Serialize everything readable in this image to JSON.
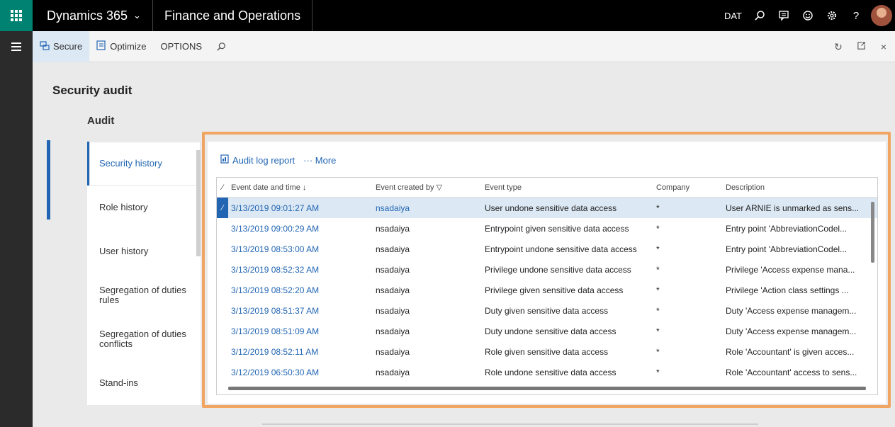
{
  "topbar": {
    "brand": "Dynamics 365",
    "app_name": "Finance and Operations",
    "company": "DAT",
    "icons": [
      "waffle-icon",
      "search-icon",
      "chat-icon",
      "smiley-icon",
      "gear-icon",
      "help-icon",
      "avatar"
    ]
  },
  "actionpane": {
    "secure": "Secure",
    "optimize": "Optimize",
    "options": "OPTIONS"
  },
  "page": {
    "title": "Security audit",
    "section": "Audit"
  },
  "vtabs": [
    {
      "label": "Security history"
    },
    {
      "label": "Role history"
    },
    {
      "label": "User history"
    },
    {
      "label": "Segregation of duties rules"
    },
    {
      "label": "Segregation of duties conflicts"
    },
    {
      "label": "Stand-ins"
    }
  ],
  "toolbar": {
    "audit_log_report": "Audit log report",
    "more": "··· More"
  },
  "grid": {
    "headers": {
      "date": "Event date and time ↓",
      "created_by": "Event created by",
      "event_type": "Event type",
      "company": "Company",
      "description": "Description"
    },
    "rows": [
      {
        "date": "3/13/2019 09:01:27 AM",
        "by": "nsadaiya",
        "type": "User undone sensitive data access",
        "company": "*",
        "desc": "User ARNIE is unmarked as sens..."
      },
      {
        "date": "3/13/2019 09:00:29 AM",
        "by": "nsadaiya",
        "type": "Entrypoint given sensitive data access",
        "company": "*",
        "desc": "Entry point 'AbbreviationCodel..."
      },
      {
        "date": "3/13/2019 08:53:00 AM",
        "by": "nsadaiya",
        "type": "Entrypoint undone sensitive data access",
        "company": "*",
        "desc": "Entry point 'AbbreviationCodel..."
      },
      {
        "date": "3/13/2019 08:52:32 AM",
        "by": "nsadaiya",
        "type": "Privilege undone sensitive data access",
        "company": "*",
        "desc": "Privilege 'Access expense mana..."
      },
      {
        "date": "3/13/2019 08:52:20 AM",
        "by": "nsadaiya",
        "type": "Privilege given sensitive data access",
        "company": "*",
        "desc": "Privilege 'Action class settings ..."
      },
      {
        "date": "3/13/2019 08:51:37 AM",
        "by": "nsadaiya",
        "type": "Duty given sensitive data access",
        "company": "*",
        "desc": "Duty 'Access expense managem..."
      },
      {
        "date": "3/13/2019 08:51:09 AM",
        "by": "nsadaiya",
        "type": "Duty undone sensitive data access",
        "company": "*",
        "desc": "Duty 'Access expense managem..."
      },
      {
        "date": "3/12/2019 08:52:11 AM",
        "by": "nsadaiya",
        "type": "Role given sensitive data access",
        "company": "*",
        "desc": "Role 'Accountant' is given acces..."
      },
      {
        "date": "3/12/2019 06:50:30 AM",
        "by": "nsadaiya",
        "type": "Role undone sensitive data access",
        "company": "*",
        "desc": "Role 'Accountant' access to sens..."
      }
    ]
  },
  "colors": {
    "accent": "#2266b3",
    "highlight": "#f0a562",
    "waffle": "#008272"
  }
}
